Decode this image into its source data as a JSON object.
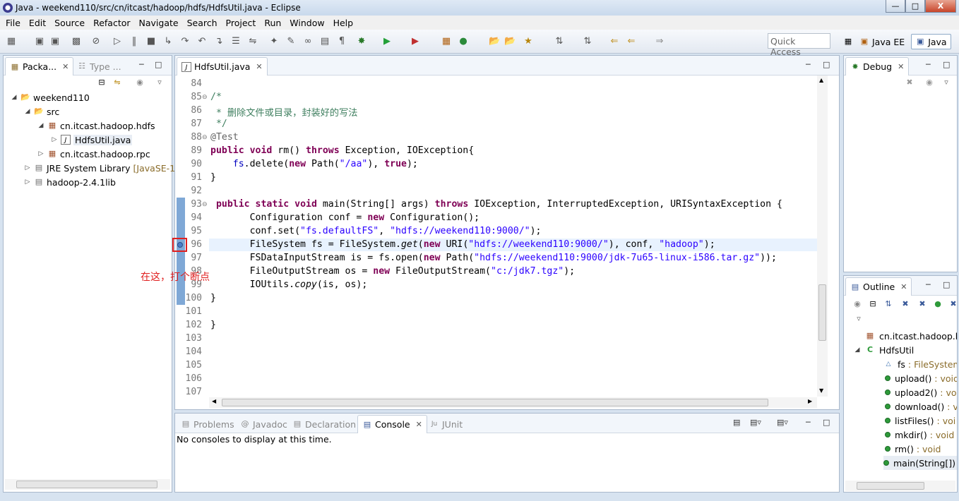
{
  "window": {
    "title": "Java - weekend110/src/cn/itcast/hadoop/hdfs/HdfsUtil.java - Eclipse",
    "min": "—",
    "max": "□",
    "close": "X"
  },
  "menu": [
    "File",
    "Edit",
    "Source",
    "Refactor",
    "Navigate",
    "Search",
    "Project",
    "Run",
    "Window",
    "Help"
  ],
  "toolbar": {
    "quick_access": "Quick Access",
    "perspectives": [
      "Java EE",
      "Java"
    ]
  },
  "explorer": {
    "tabs": [
      "Packa...",
      "Type ..."
    ],
    "tree": [
      {
        "label": "weekend110",
        "level": 0
      },
      {
        "label": "src",
        "level": 1
      },
      {
        "label": "cn.itcast.hadoop.hdfs",
        "level": 2
      },
      {
        "label": "HdfsUtil.java",
        "level": 3
      },
      {
        "label": "cn.itcast.hadoop.rpc",
        "level": 2
      },
      {
        "label": "JRE System Library",
        "suffix": "[JavaSE-1.",
        "level": 1
      },
      {
        "label": "hadoop-2.4.1lib",
        "level": 1
      }
    ]
  },
  "editor": {
    "tab": "HdfsUtil.java",
    "line_numbers": [
      "84",
      "85",
      "86",
      "87",
      "88",
      "89",
      "90",
      "91",
      "92",
      "93",
      "94",
      "95",
      "96",
      "97",
      "98",
      "99",
      "100",
      "101",
      "102",
      "103",
      "104",
      "105",
      "106",
      "107"
    ],
    "annotation": "在这，打个断点"
  },
  "console": {
    "tabs": [
      "Problems",
      "Javadoc",
      "Declaration",
      "Console",
      "JUnit"
    ],
    "message": "No consoles to display at this time."
  },
  "debug": {
    "tab": "Debug"
  },
  "outline": {
    "tab": "Outline",
    "package": "cn.itcast.hadoop.h",
    "class": "HdfsUtil",
    "members": [
      {
        "name": "fs",
        "type": " : FileSystem"
      },
      {
        "name": "upload()",
        "type": " : void"
      },
      {
        "name": "upload2()",
        "type": " : vo"
      },
      {
        "name": "download()",
        "type": " : v"
      },
      {
        "name": "listFiles()",
        "type": " : voi"
      },
      {
        "name": "mkdir()",
        "type": " : void"
      },
      {
        "name": "rm()",
        "type": " : void"
      },
      {
        "name": "main(String[])",
        "type": ""
      }
    ]
  },
  "colors": {
    "keyword": "#7f0055",
    "string": "#2a00ff",
    "comment": "#3f7f5f",
    "field": "#0000c0",
    "breakpoint_box": "#e02020"
  }
}
